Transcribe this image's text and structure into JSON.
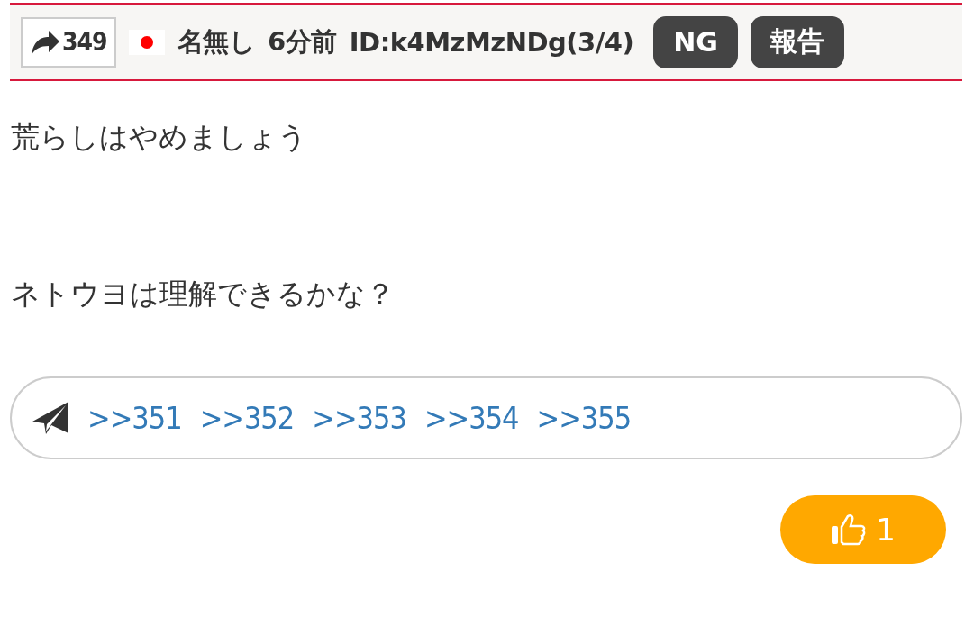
{
  "post_header": {
    "reply_count": "349",
    "name": "名無し",
    "time": "6分前",
    "id": "ID:k4MzMzNDg(3/4)",
    "buttons": [
      "NG",
      "報告"
    ]
  },
  "body": [
    "荒らしはやめましょう",
    "ネトウヨは理解できるかな？"
  ],
  "replies": [
    ">>351",
    ">>352",
    ">>353",
    ">>354",
    ">>355"
  ],
  "like": {
    "count": "1"
  }
}
